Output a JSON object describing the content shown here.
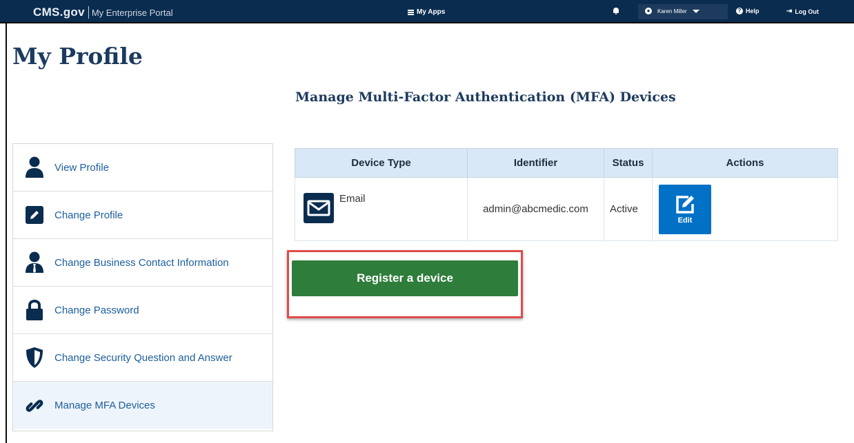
{
  "topbar": {
    "brand": "CMS.gov",
    "portal": "My Enterprise Portal",
    "my_apps": "My Apps",
    "user_name": "Karen Miller",
    "help": "Help",
    "logout": "Log Out",
    "bg_color": "#0a2c4f"
  },
  "page": {
    "title": "My Profile",
    "section_title": "Manage Multi-Factor Authentication (MFA) Devices"
  },
  "sidebar": {
    "items": [
      {
        "label": "View Profile",
        "icon": "user-icon"
      },
      {
        "label": "Change Profile",
        "icon": "pencil-icon"
      },
      {
        "label": "Change Business Contact Information",
        "icon": "business-user-icon"
      },
      {
        "label": "Change Password",
        "icon": "lock-icon"
      },
      {
        "label": "Change Security Question and Answer",
        "icon": "shield-icon"
      },
      {
        "label": "Manage MFA Devices",
        "icon": "link-icon",
        "active": true
      }
    ]
  },
  "table": {
    "headers": [
      "Device Type",
      "Identifier",
      "Status",
      "Actions"
    ],
    "rows": [
      {
        "device_type": "Email",
        "identifier": "admin@abcmedic.com",
        "status": "Active",
        "action_label": "Edit"
      }
    ]
  },
  "register": {
    "label": "Register a device",
    "button_color": "#2e7d3b",
    "highlight_color": "#e04b4b"
  }
}
